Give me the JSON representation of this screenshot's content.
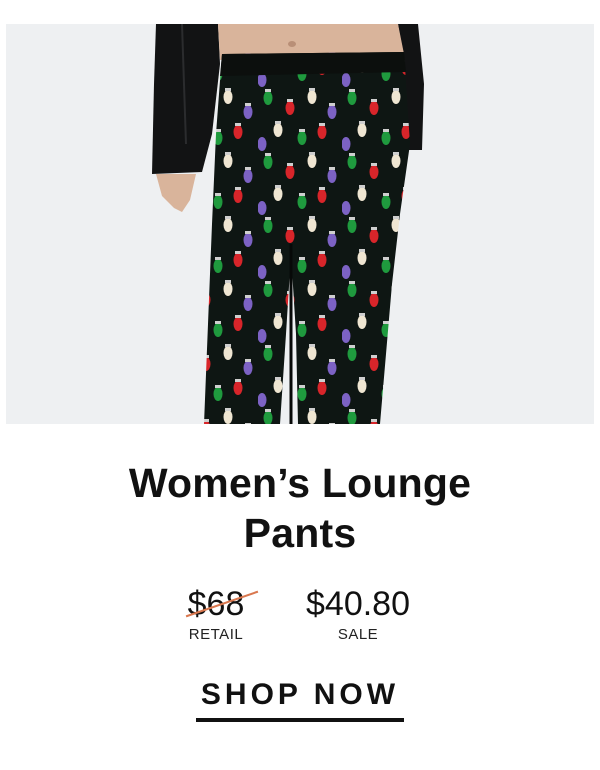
{
  "product": {
    "image_alt": "Women's lounge pants with holiday light bulb print",
    "title_line1": "Women’s Lounge",
    "title_line2": "Pants"
  },
  "pricing": {
    "retail_price": "$68",
    "retail_label": "RETAIL",
    "sale_price": "$40.80",
    "sale_label": "SALE"
  },
  "cta": {
    "label": "SHOP NOW"
  },
  "colors": {
    "image_background": "#eef0f2",
    "pants": "#0e1613",
    "strike": "#d9774e",
    "bulb_red": "#d8252a",
    "bulb_green": "#1f9a3e",
    "bulb_purple": "#7c62c4",
    "bulb_cream": "#efe6d2"
  }
}
